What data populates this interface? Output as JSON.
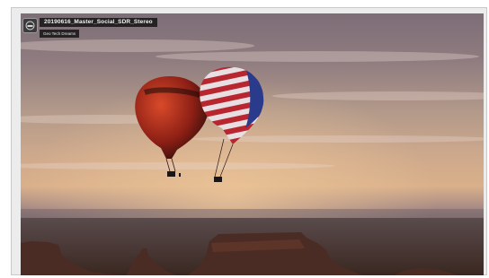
{
  "player": {
    "title": "20190616_Master_Social_SDR_Stereo",
    "channel": "Geo Tech Dreams",
    "avatar_icon": "channel-avatar-icon"
  },
  "colors": {
    "frame_background": "#ececec",
    "frame_border": "#c9c9c9",
    "overlay_background": "#141414",
    "overlay_text": "#f2f2f2"
  }
}
